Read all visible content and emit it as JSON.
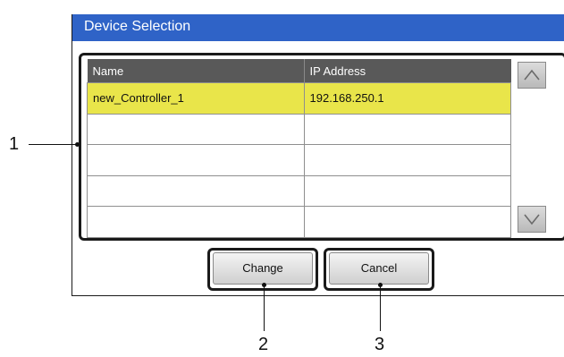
{
  "dialog": {
    "title": "Device Selection",
    "table": {
      "columns": [
        "Name",
        "IP Address"
      ],
      "rows": [
        [
          "new_Controller_1",
          "192.168.250.1"
        ],
        [
          "",
          ""
        ],
        [
          "",
          ""
        ],
        [
          "",
          ""
        ],
        [
          "",
          ""
        ]
      ],
      "selected_row": 0
    },
    "scroll_up_icon": "chevron-up-icon",
    "scroll_down_icon": "chevron-down-icon",
    "buttons": {
      "change_label": "Change",
      "cancel_label": "Cancel"
    }
  },
  "callouts": {
    "one": "1",
    "two": "2",
    "three": "3"
  },
  "colors": {
    "titlebar": "#2f63c7",
    "header": "#595959",
    "selected_row": "#e9e54a"
  }
}
